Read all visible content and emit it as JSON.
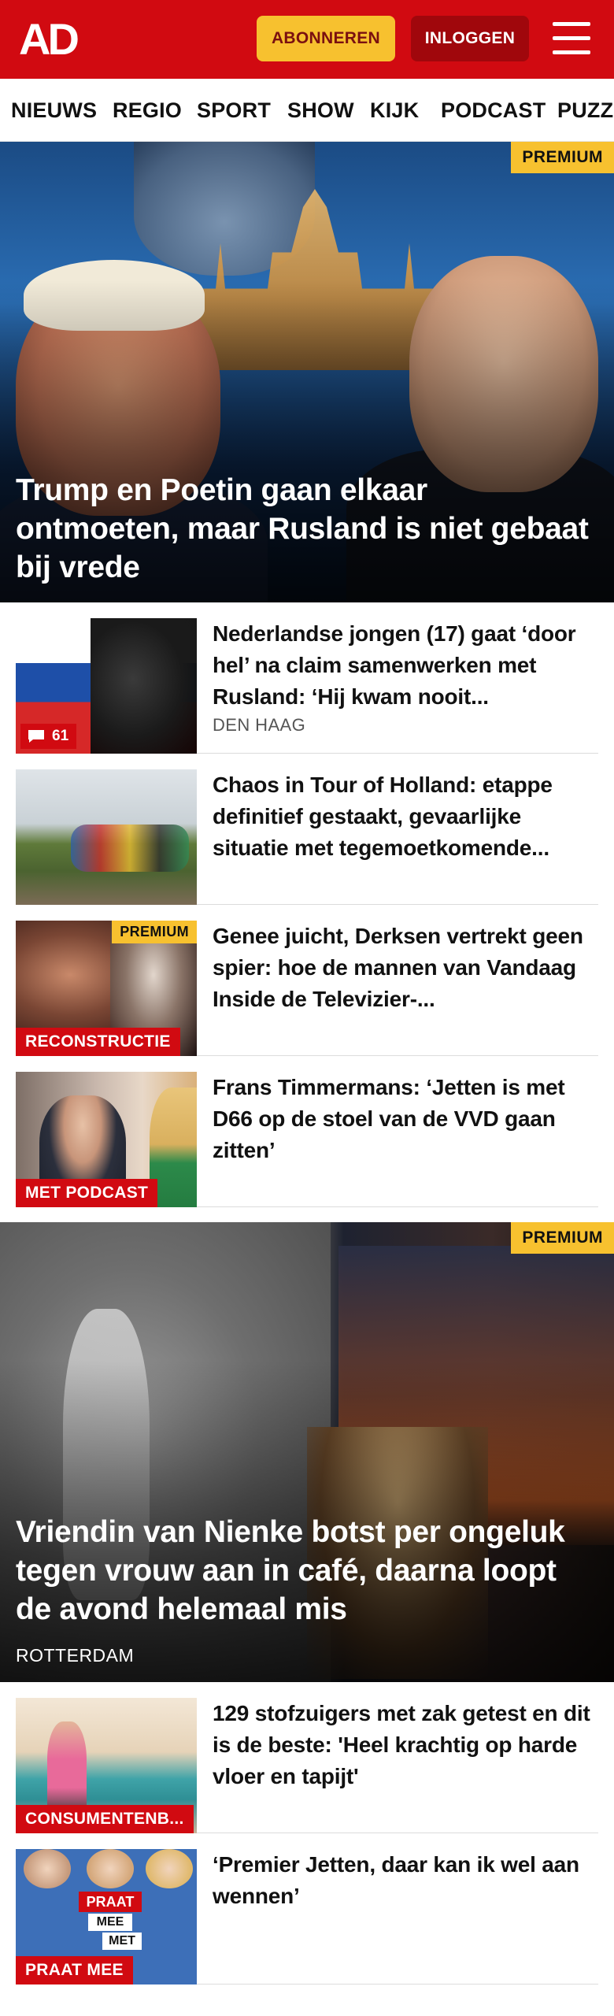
{
  "header": {
    "logo": "AD",
    "subscribe_label": "ABONNEREN",
    "login_label": "INLOGGEN",
    "menu_icon": "hamburger-menu-icon",
    "colors": {
      "brand_red": "#d10a11",
      "accent_yellow": "#f7c12f",
      "login_dark_red": "#a0070c"
    }
  },
  "nav": {
    "items": [
      "NIEUWS",
      "REGIO",
      "SPORT",
      "SHOW",
      "KIJK",
      "PODCAST",
      "PUZZ"
    ]
  },
  "hero_top": {
    "badge": "PREMIUM",
    "title": "Trump en Poetin gaan elkaar ontmoeten, maar Rusland is niet gebaat bij vrede"
  },
  "articles": [
    {
      "title": "Nederlandse jongen (17) gaat ‘door hel’ na claim samenwerken met Rusland: ‘Hij kwam nooit...",
      "location": "DEN HAAG",
      "comments": "61"
    },
    {
      "title": "Chaos in Tour of Holland: etappe definitief gestaakt, gevaarlijke situatie met tegemoetkomende..."
    },
    {
      "title": "Genee juicht, Derksen vertrekt geen spier: hoe de mannen van Vandaag Inside de Televizier-...",
      "badge": "PREMIUM",
      "label": "RECONSTRUCTIE"
    },
    {
      "title": "Frans Timmermans: ‘Jetten is met D66 op de stoel van de VVD gaan zitten’",
      "label": "MET PODCAST"
    }
  ],
  "hero_bottom": {
    "badge": "PREMIUM",
    "title": "Vriendin van Nienke botst per ongeluk tegen vrouw aan in café, daarna loopt de avond helemaal mis",
    "location": "ROTTERDAM"
  },
  "articles_bottom": [
    {
      "title": "129 stofzuigers met zak getest en dit is de beste: 'Heel krachtig op harde vloer en tapijt'",
      "label": "CONSUMENTENB..."
    },
    {
      "title": "‘Premier Jetten, daar kan ik wel aan wennen’",
      "label": "PRAAT MEE",
      "thumb_text": [
        "PRAAT",
        "MEE",
        "MET"
      ]
    }
  ]
}
